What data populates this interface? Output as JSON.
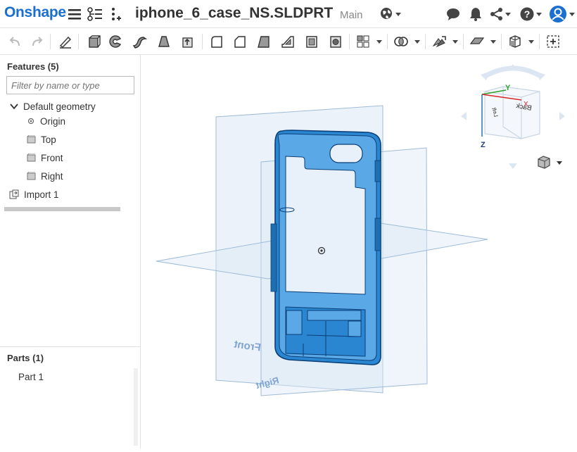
{
  "app": {
    "logo": "Onshape",
    "document_name": "iphone_6_case_NS.SLDPRT",
    "workspace": "Main"
  },
  "header_icons": [
    "menu-icon",
    "versions-icon",
    "branch-icon",
    "globe-icon",
    "comment-icon",
    "notification-icon",
    "share-icon",
    "help-icon",
    "user-icon"
  ],
  "toolbar": {
    "tools": [
      "undo",
      "redo",
      "sketch",
      "extrude",
      "revolve",
      "sweep",
      "loft",
      "thicken",
      "fillet",
      "chamfer",
      "draft",
      "rib",
      "shell",
      "hole",
      "pattern",
      "boolean",
      "transform",
      "plane",
      "mate-connector"
    ]
  },
  "features": {
    "title": "Features (5)",
    "filter_placeholder": "Filter by name or type",
    "group_label": "Default geometry",
    "items": [
      {
        "label": "Origin",
        "icon": "origin-icon"
      },
      {
        "label": "Top",
        "icon": "plane-icon"
      },
      {
        "label": "Front",
        "icon": "plane-icon"
      },
      {
        "label": "Right",
        "icon": "plane-icon"
      }
    ],
    "import_label": "Import 1"
  },
  "parts": {
    "title": "Parts (1)",
    "items": [
      "Part 1"
    ]
  },
  "viewport": {
    "plane_labels": {
      "front": "Front",
      "right": "Right"
    },
    "view_cube": {
      "y": "Y",
      "x": "X",
      "z": "Z",
      "back": "Back",
      "left": "Left"
    }
  },
  "colors": {
    "brand": "#1a6fcf",
    "model_blue": "#2a86d0",
    "plane_fill": "#dbe8f5",
    "plane_stroke": "#9fbbd8"
  }
}
